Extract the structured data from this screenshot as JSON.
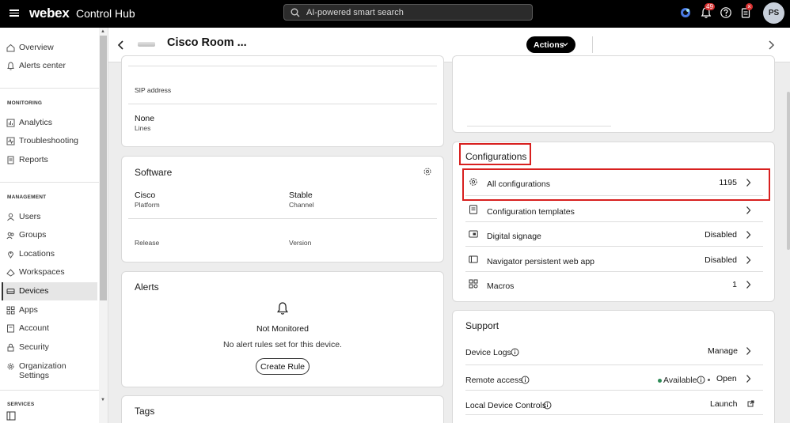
{
  "app": {
    "brand": "webex",
    "product": "Control Hub"
  },
  "search": {
    "placeholder": "AI-powered smart search"
  },
  "topbar": {
    "notifications_count": "49",
    "avatar_initials": "PS",
    "icons": [
      "menu-icon",
      "webex-status-icon",
      "bell-icon",
      "help-icon",
      "tasks-icon"
    ]
  },
  "sidebar": {
    "items_top": [
      {
        "label": "Overview",
        "icon": "home-icon"
      },
      {
        "label": "Alerts center",
        "icon": "bell-icon"
      }
    ],
    "monitoring_header": "MONITORING",
    "monitoring": [
      {
        "label": "Analytics",
        "icon": "chart-icon"
      },
      {
        "label": "Troubleshooting",
        "icon": "pulse-icon"
      },
      {
        "label": "Reports",
        "icon": "report-icon"
      }
    ],
    "management_header": "MANAGEMENT",
    "management": [
      {
        "label": "Users",
        "icon": "user-icon"
      },
      {
        "label": "Groups",
        "icon": "group-icon"
      },
      {
        "label": "Locations",
        "icon": "location-icon"
      },
      {
        "label": "Workspaces",
        "icon": "workspace-icon"
      },
      {
        "label": "Devices",
        "icon": "device-icon",
        "active": true
      },
      {
        "label": "Apps",
        "icon": "apps-icon"
      },
      {
        "label": "Account",
        "icon": "account-icon"
      },
      {
        "label": "Security",
        "icon": "lock-icon"
      },
      {
        "label": "Organization Settings",
        "icon": "gear-icon"
      }
    ],
    "services_header": "SERVICES"
  },
  "header": {
    "title": "Cisco Room ...",
    "actions_label": "Actions"
  },
  "left": {
    "sip": {
      "label": "SIP address"
    },
    "lines": {
      "value": "None",
      "label": "Lines"
    },
    "software": {
      "title": "Software",
      "platform_value": "Cisco",
      "platform_label": "Platform",
      "channel_value": "Stable",
      "channel_label": "Channel",
      "release_label": "Release",
      "version_label": "Version"
    },
    "alerts": {
      "title": "Alerts",
      "status": "Not Monitored",
      "message": "No alert rules set for this device.",
      "create_rule_label": "Create Rule"
    },
    "tags": {
      "title": "Tags"
    }
  },
  "configurations": {
    "title": "Configurations",
    "rows": [
      {
        "label": "All configurations",
        "value": "1195",
        "icon": "gear-icon"
      },
      {
        "label": "Configuration templates",
        "value": "",
        "icon": "template-icon"
      },
      {
        "label": "Digital signage",
        "value": "Disabled",
        "icon": "signage-icon"
      },
      {
        "label": "Navigator persistent web app",
        "value": "Disabled",
        "icon": "web-app-icon"
      },
      {
        "label": "Macros",
        "value": "1",
        "icon": "macro-icon"
      }
    ]
  },
  "support": {
    "title": "Support",
    "device_logs_label": "Device Logs",
    "device_logs_action": "Manage",
    "remote_access_label": "Remote access",
    "remote_access_status": "Available",
    "remote_access_action": "Open",
    "local_controls_label": "Local Device Controls",
    "local_controls_action": "Launch"
  },
  "colors": {
    "highlight": "#d8201f",
    "available_dot": "#2e8b57",
    "topbar": "#000000"
  }
}
